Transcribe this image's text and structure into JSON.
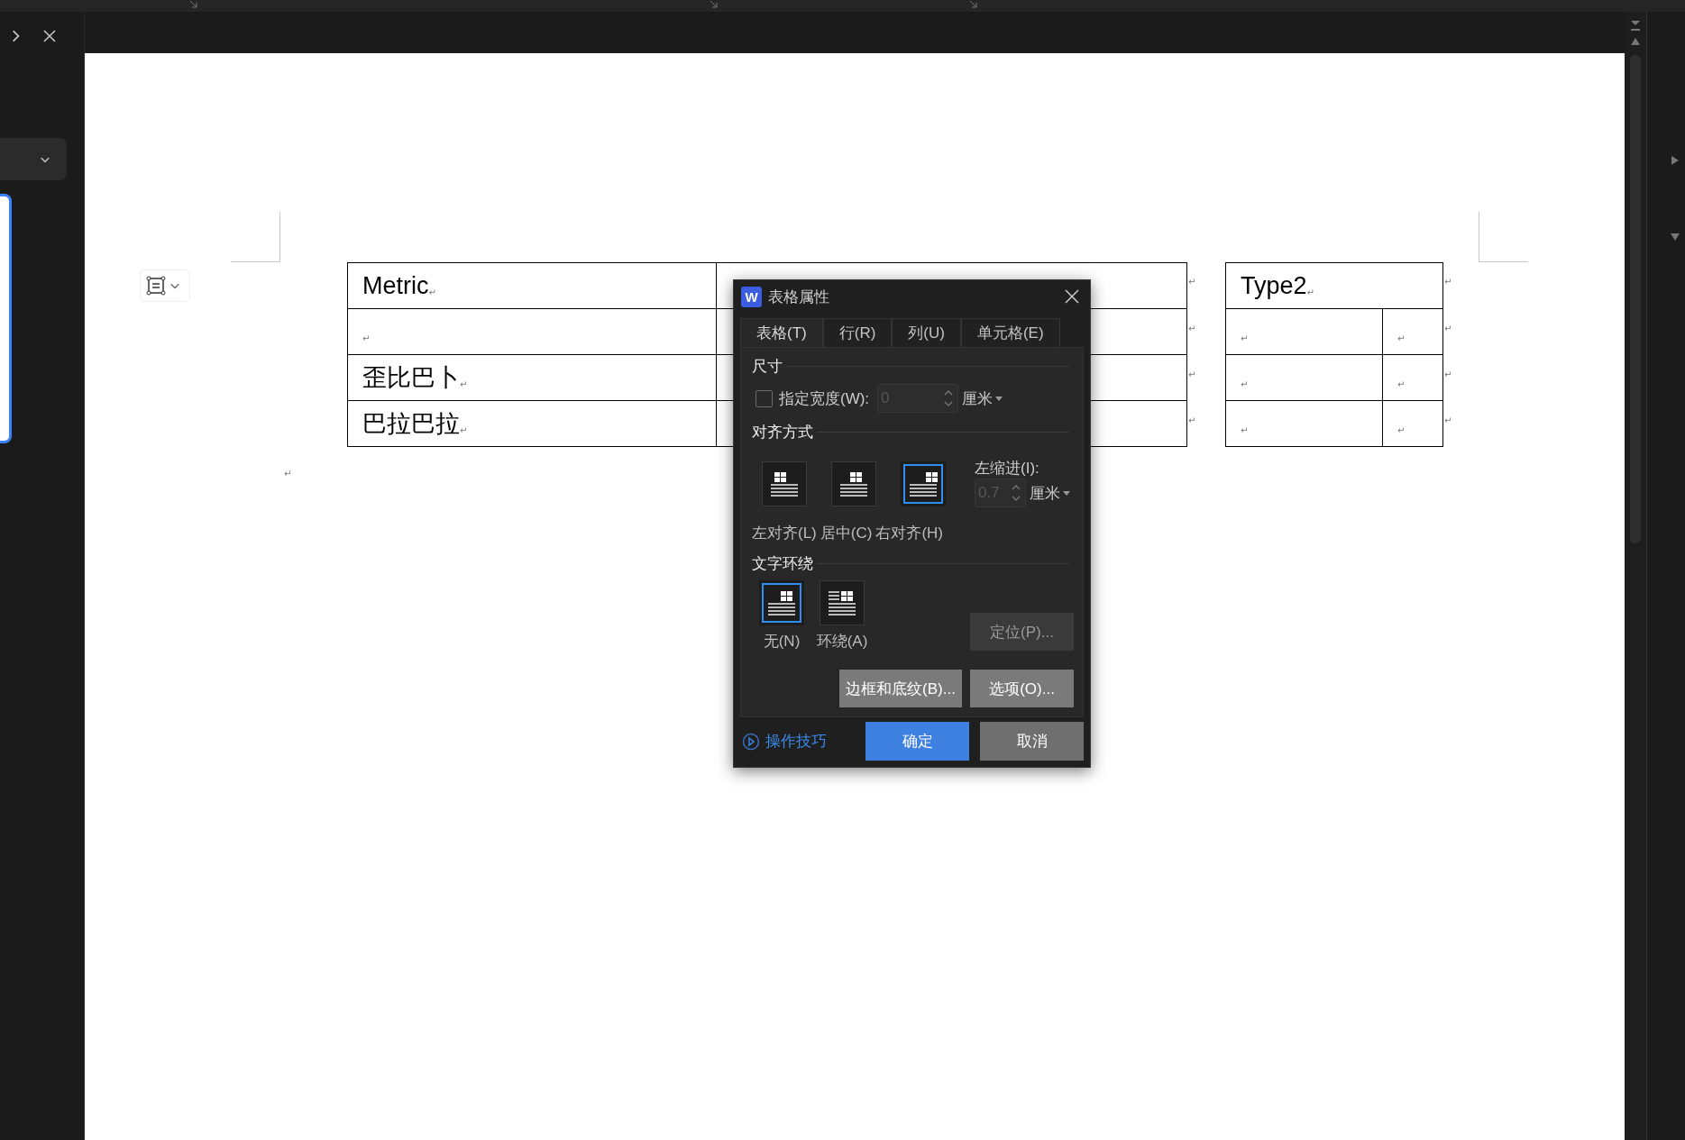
{
  "document": {
    "tables": [
      {
        "rows": [
          {
            "cells": [
              {
                "kind": "text",
                "text": "Metric",
                "mark": "↵"
              },
              {
                "kind": "blank"
              }
            ],
            "end_mark": "↵"
          },
          {
            "cells": [
              {
                "kind": "text",
                "mark": "↵"
              },
              {
                "kind": "blank"
              }
            ],
            "end_mark": "↵"
          },
          {
            "cells": [
              {
                "kind": "text",
                "text": "歪比巴卜",
                "mark": "↵"
              },
              {
                "kind": "blank"
              }
            ],
            "end_mark": "↵"
          },
          {
            "cells": [
              {
                "kind": "text",
                "text": "巴拉巴拉",
                "mark": "↵"
              },
              {
                "kind": "blank"
              }
            ],
            "end_mark": "↵"
          }
        ]
      },
      {
        "rows": [
          {
            "cells": [
              {
                "kind": "text",
                "text": "Type2",
                "mark": "↵"
              }
            ],
            "end_mark": "↵"
          },
          {
            "cells": [
              {
                "kind": "text",
                "mark": "↵"
              },
              {
                "kind": "text",
                "mark": "↵"
              }
            ],
            "end_mark": "↵"
          },
          {
            "cells": [
              {
                "kind": "text",
                "mark": "↵"
              },
              {
                "kind": "text",
                "mark": "↵"
              }
            ],
            "end_mark": "↵"
          },
          {
            "cells": [
              {
                "kind": "text",
                "mark": "↵"
              },
              {
                "kind": "text",
                "mark": "↵"
              }
            ],
            "end_mark": "↵"
          }
        ]
      }
    ],
    "trailing_mark": "↵"
  },
  "dialog": {
    "logo": "W",
    "title": "表格属性",
    "tabs": [
      {
        "label": "表格(T)",
        "selected": true
      },
      {
        "label": "行(R)",
        "selected": false
      },
      {
        "label": "列(U)",
        "selected": false
      },
      {
        "label": "单元格(E)",
        "selected": false
      }
    ],
    "size": {
      "heading": "尺寸",
      "width_checkbox": {
        "label": "指定宽度(W):",
        "checked": false
      },
      "width_field": {
        "value": "0",
        "disabled": true
      },
      "unit": "厘米"
    },
    "alignment": {
      "heading": "对齐方式",
      "options": [
        {
          "kind": "left",
          "label": "左对齐(L)",
          "selected": false
        },
        {
          "kind": "center",
          "label": "居中(C)",
          "selected": false
        },
        {
          "kind": "right",
          "label": "右对齐(H)",
          "selected": true
        }
      ],
      "indent_label": "左缩进(I):",
      "indent_field": {
        "value": "0.7",
        "disabled": true
      },
      "unit": "厘米"
    },
    "text_wrap": {
      "heading": "文字环绕",
      "options": [
        {
          "kind": "none",
          "label": "无(N)",
          "selected": true
        },
        {
          "kind": "around",
          "label": "环绕(A)",
          "selected": false
        }
      ],
      "position_button": {
        "label": "定位(P)...",
        "disabled": true
      }
    },
    "buttons": [
      {
        "label": "边框和底纹(B)..."
      },
      {
        "label": "选项(O)..."
      }
    ],
    "tips_link": "操作技巧",
    "ok": "确定",
    "cancel": "取消"
  }
}
